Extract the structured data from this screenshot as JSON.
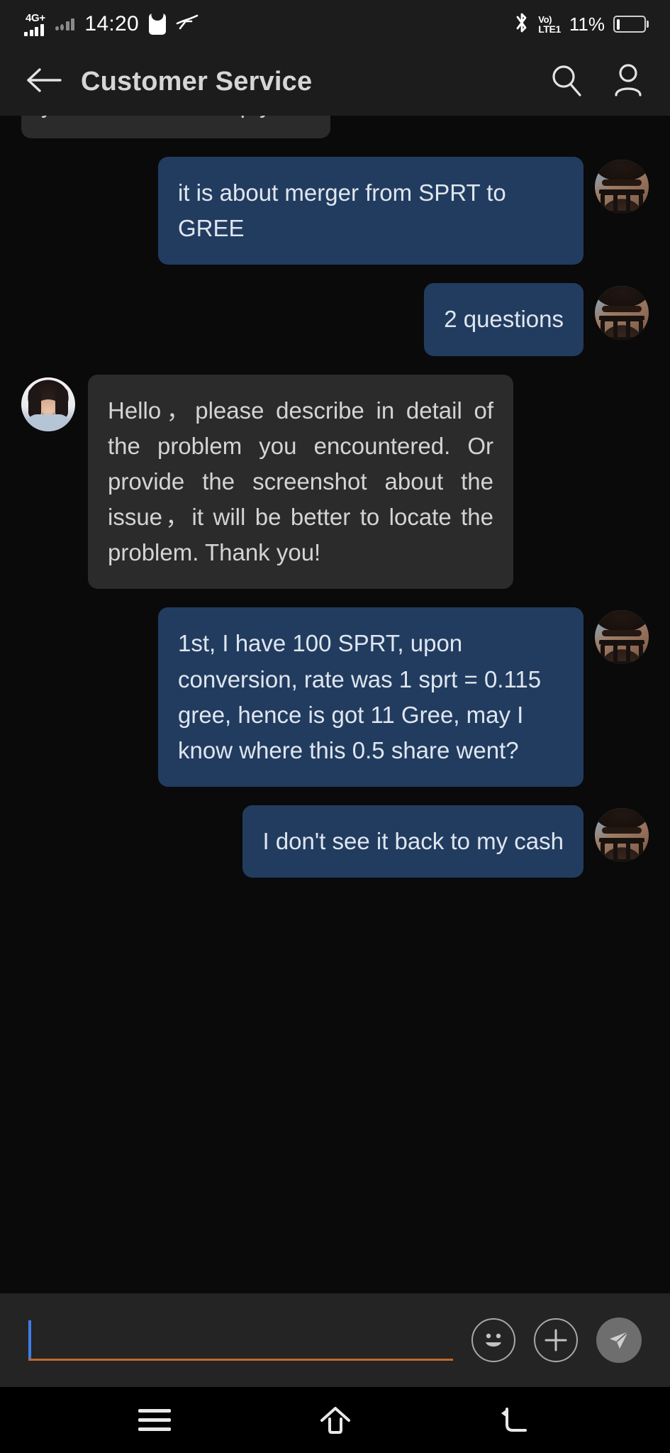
{
  "status_bar": {
    "network_label": "4G+",
    "time": "14:20",
    "icons": [
      "signal-bars-icon",
      "signal-bars-secondary-icon",
      "app-notification-icon",
      "bird-icon",
      "bluetooth-icon"
    ],
    "volte_top": "Vo)",
    "volte_bottom": "LTE1",
    "battery_percent": "11%",
    "battery_level": 11
  },
  "header": {
    "back_label": "back-arrow",
    "title": "Customer Service",
    "search_label": "search",
    "profile_label": "profile"
  },
  "chat": {
    "messages": [
      {
        "id": "m0",
        "side": "in",
        "clipped": true,
        "text": "you? How can I help you?",
        "avatar": "agent"
      },
      {
        "id": "m1",
        "side": "out",
        "text": "it is about merger from SPRT to GREE",
        "avatar": "user"
      },
      {
        "id": "m2",
        "side": "out",
        "text": "2 questions",
        "avatar": "user"
      },
      {
        "id": "m3",
        "side": "in",
        "text": "Hello，please describe in detail of the problem you encountered. Or provide the screenshot about the issue，it will be better to locate the problem. Thank you!",
        "avatar": "agent"
      },
      {
        "id": "m4",
        "side": "out",
        "text": "1st, I have 100 SPRT, upon conversion, rate was 1 sprt = 0.115 gree, hence is got 11 Gree, may I know where this 0.5 share went?",
        "avatar": "user"
      },
      {
        "id": "m5",
        "side": "out",
        "text": "I don't see it back to my cash",
        "avatar": "user"
      }
    ]
  },
  "input_bar": {
    "value": "",
    "placeholder": "",
    "emoji_label": "emoji",
    "plus_label": "add attachment",
    "send_label": "send"
  },
  "nav_bar": {
    "recents_label": "recent apps",
    "home_label": "home",
    "back_label": "back"
  },
  "colors": {
    "outgoing_bubble": "#223c60",
    "incoming_bubble": "#2b2b2b",
    "header_bg": "#1c1c1c",
    "chat_bg": "#0a0a0a",
    "input_bg": "#242424",
    "caret": "#3d7dea",
    "underline": "#c06a2a"
  }
}
